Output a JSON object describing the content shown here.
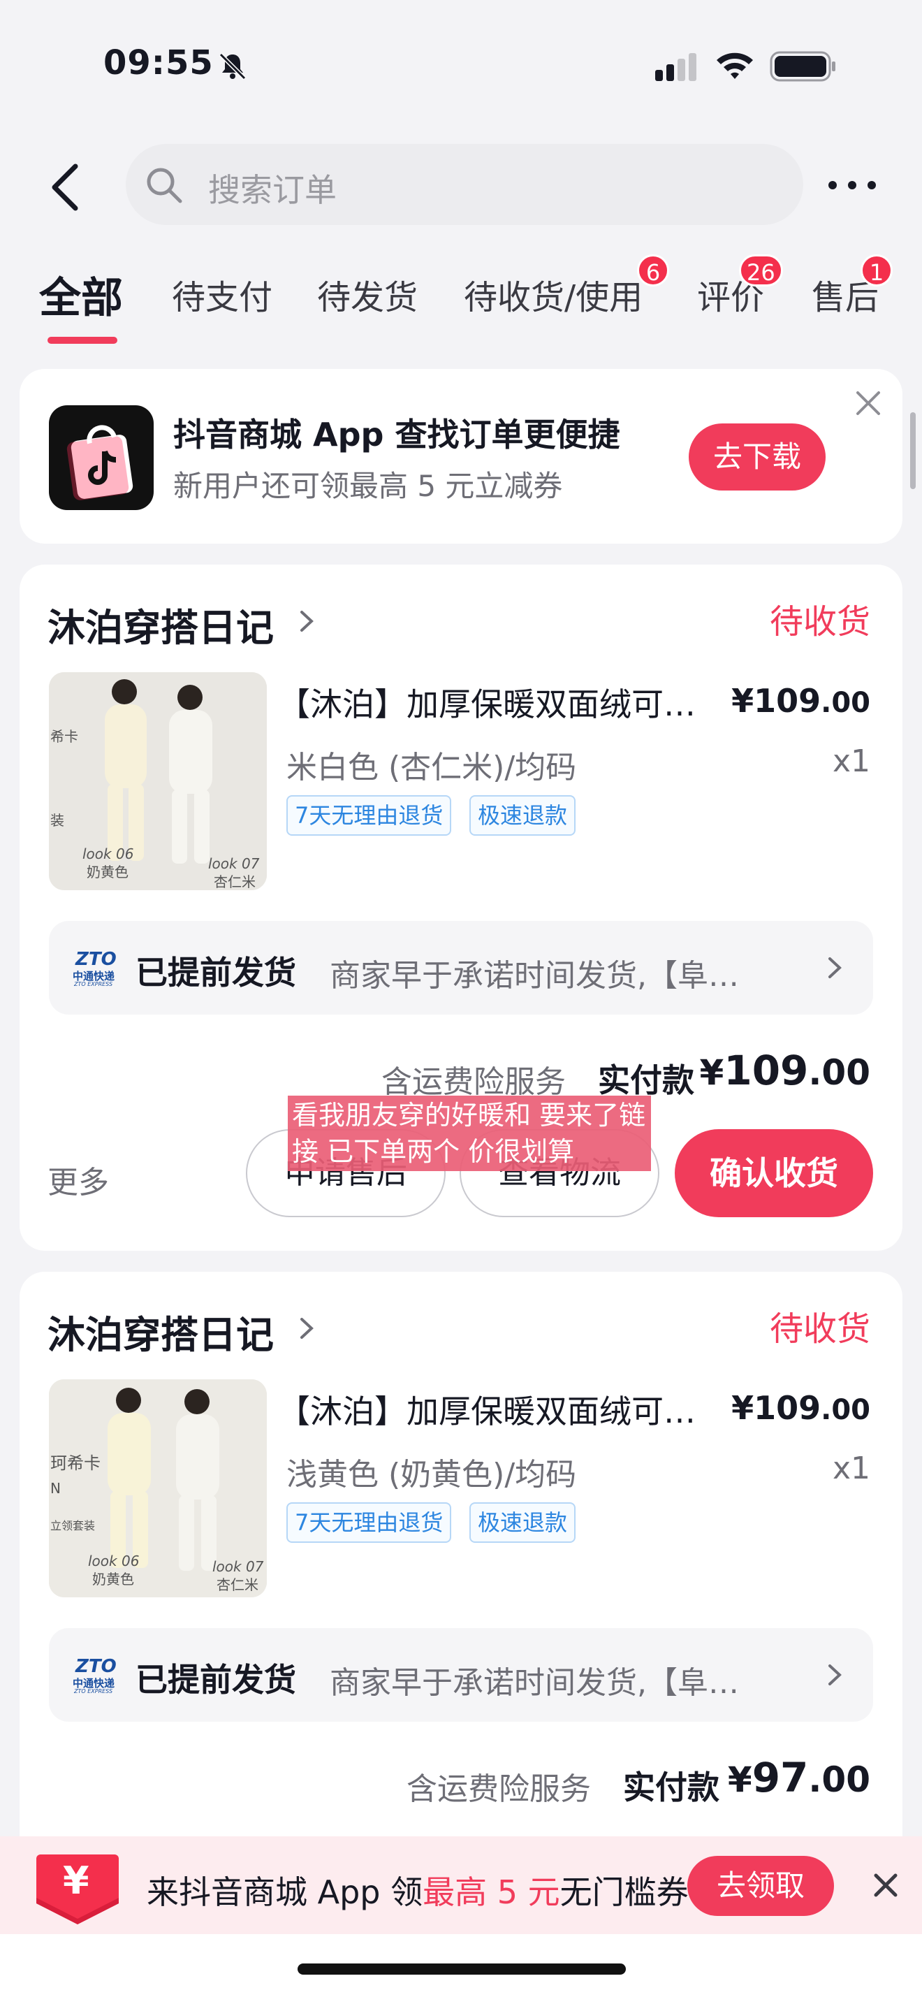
{
  "status_bar": {
    "time": "09:55"
  },
  "search": {
    "placeholder": "搜索订单"
  },
  "tabs": [
    {
      "label": "全部",
      "badge": null
    },
    {
      "label": "待支付",
      "badge": null
    },
    {
      "label": "待发货",
      "badge": null
    },
    {
      "label": "待收货/使用",
      "badge": "6"
    },
    {
      "label": "评价",
      "badge": "26"
    },
    {
      "label": "售后",
      "badge": "1"
    }
  ],
  "promo": {
    "title": "抖音商城 App 查找订单更便捷",
    "subtitle": "新用户还可领最高 5 元立减券",
    "button": "去下载"
  },
  "orders": [
    {
      "shop": "沐泊穿搭日记",
      "status": "待收货",
      "product_title": "【沐泊】加厚保暖双面绒可…",
      "price_int": "¥109",
      "price_dec": ".00",
      "variant": "米白色 (杏仁米)/均码",
      "qty": "x1",
      "tags": [
        "7天无理由退货",
        "极速退款"
      ],
      "logistics_title": "已提前发货",
      "logistics_desc": "商家早于承诺时间发货,【阜…",
      "insurance": "含运费险服务",
      "paid_label": "实付款",
      "total_cur": "¥",
      "total_int": "109",
      "total_dec": ".00",
      "more": "更多",
      "btn_after_sale": "申请售后",
      "btn_logistics": "查看物流",
      "btn_confirm": "确认收货"
    },
    {
      "shop": "沐泊穿搭日记",
      "status": "待收货",
      "product_title": "【沐泊】加厚保暖双面绒可…",
      "price_int": "¥109",
      "price_dec": ".00",
      "variant": "浅黄色 (奶黄色)/均码",
      "qty": "x1",
      "tags": [
        "7天无理由退货",
        "极速退款"
      ],
      "logistics_title": "已提前发货",
      "logistics_desc": "商家早于承诺时间发货,【阜…",
      "insurance": "含运费险服务",
      "paid_label": "实付款",
      "total_cur": "¥",
      "total_int": "97",
      "total_dec": ".00"
    }
  ],
  "thumb_labels": {
    "o1": [
      "希卡",
      "装",
      "look 06",
      "奶黄色",
      "look 07",
      "杏仁米"
    ],
    "o2": [
      "珂希卡",
      "N",
      "立领套装",
      "look 06",
      "奶黄色",
      "look 07",
      "杏仁米"
    ]
  },
  "zto": {
    "brand": "ZTO",
    "cn": "中通快递",
    "en": "ZTO EXPRESS"
  },
  "overlay_caption": "看我朋友穿的好暖和 要来了链接 已下单两个 价很划算",
  "bottom_banner": {
    "prefix": "来抖音商城 App 领",
    "highlight": "最高 5 元",
    "suffix": "无门槛券",
    "button": "去领取",
    "coupon_symbol": "¥"
  },
  "colors": {
    "accent": "#f13c5b",
    "tag_blue": "#2d86e0",
    "background": "#f3f3f6"
  },
  "icons": [
    "bell-off-icon",
    "signal-icon",
    "wifi-icon",
    "battery-icon",
    "back-arrow-icon",
    "search-icon",
    "more-dots-icon",
    "close-icon",
    "chevron-right-icon",
    "tiktok-shop-logo",
    "zto-logo",
    "coupon-icon"
  ]
}
